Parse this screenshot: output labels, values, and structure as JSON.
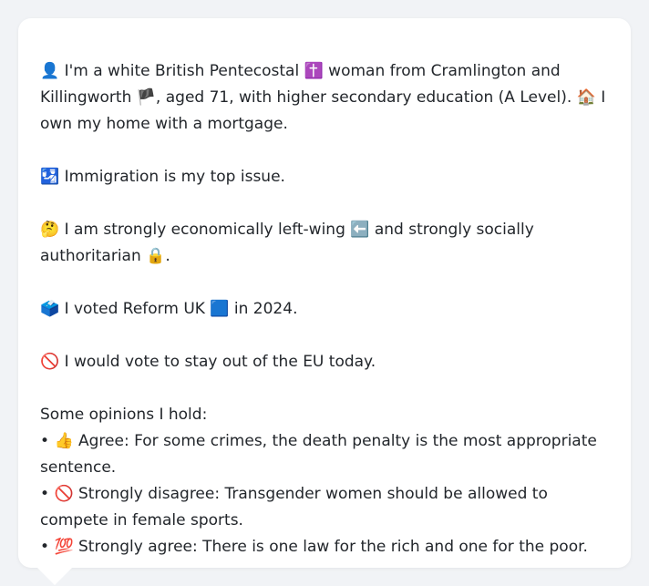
{
  "profile": {
    "intro_icon": "👤",
    "intro_a": " I'm a white British Pentecostal ",
    "religion_icon": "✝️",
    "intro_b": " woman from Cramlington and Killingworth ",
    "flag_icon": "🏴",
    "intro_c": ", aged 71, with higher secondary education (A Level). ",
    "home_icon": "🏠",
    "intro_d": " I own my home with a mortgage.",
    "issue_icon": "🛂",
    "issue_text": " Immigration is my top issue.",
    "politics_icon": "🤔",
    "politics_a": " I am strongly economically left-wing ",
    "left_icon": "⬅️",
    "politics_b": " and strongly socially authoritarian ",
    "lock_icon": "🔒",
    "politics_c": ".",
    "vote_icon": "🗳️",
    "vote_a": " I voted Reform UK ",
    "party_icon": "🟦",
    "vote_b": " in 2024.",
    "eu_icon": "🚫",
    "eu_text": " I would vote to stay out of the EU today.",
    "opinions_heading": "Some opinions I hold:",
    "opinions": [
      {
        "bullet": "• ",
        "icon": "👍",
        "text": " Agree: For some crimes, the death penalty is the most appropriate sentence."
      },
      {
        "bullet": "• ",
        "icon": "🚫",
        "text": " Strongly disagree: Transgender women should be allowed to compete in female sports."
      },
      {
        "bullet": "• ",
        "icon": "💯",
        "text": " Strongly agree: There is one law for the rich and one for the poor."
      }
    ]
  },
  "colors": {
    "background": "#f1f3f6",
    "bubble": "#ffffff",
    "text": "#22262b"
  }
}
